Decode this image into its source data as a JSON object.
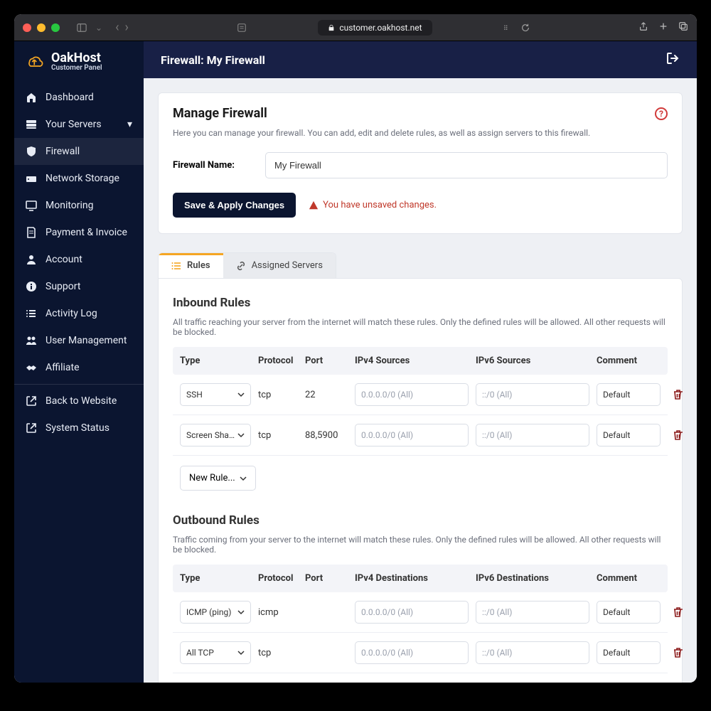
{
  "browser": {
    "url": "customer.oakhost.net"
  },
  "brand": {
    "name": "OakHost",
    "subtitle": "Customer Panel"
  },
  "sidebar": {
    "items": [
      {
        "label": "Dashboard"
      },
      {
        "label": "Your Servers"
      },
      {
        "label": "Firewall"
      },
      {
        "label": "Network Storage"
      },
      {
        "label": "Monitoring"
      },
      {
        "label": "Payment & Invoice"
      },
      {
        "label": "Account"
      },
      {
        "label": "Support"
      },
      {
        "label": "Activity Log"
      },
      {
        "label": "User Management"
      },
      {
        "label": "Affiliate"
      },
      {
        "label": "Back to Website"
      },
      {
        "label": "System Status"
      }
    ]
  },
  "topbar": {
    "title": "Firewall: My Firewall"
  },
  "manage": {
    "heading": "Manage Firewall",
    "description": "Here you can manage your firewall. You can add, edit and delete rules, as well as assign servers to this firewall.",
    "name_label": "Firewall Name:",
    "name_value": "My Firewall",
    "save_label": "Save & Apply Changes",
    "unsaved_msg": "You have unsaved changes."
  },
  "tabs": {
    "rules": "Rules",
    "assigned": "Assigned Servers"
  },
  "inbound": {
    "title": "Inbound Rules",
    "description": "All traffic reaching your server from the internet will match these rules. Only the defined rules will be allowed. All other requests will be blocked.",
    "columns": {
      "type": "Type",
      "protocol": "Protocol",
      "port": "Port",
      "v4": "IPv4 Sources",
      "v6": "IPv6 Sources",
      "comment": "Comment"
    },
    "rows": [
      {
        "type": "SSH",
        "protocol": "tcp",
        "port": "22",
        "v4_placeholder": "0.0.0.0/0 (All)",
        "v6_placeholder": "::/0 (All)",
        "comment": "Default"
      },
      {
        "type": "Screen Sharing",
        "protocol": "tcp",
        "port": "88,5900",
        "v4_placeholder": "0.0.0.0/0 (All)",
        "v6_placeholder": "::/0 (All)",
        "comment": "Default"
      }
    ],
    "new_rule_label": "New Rule..."
  },
  "outbound": {
    "title": "Outbound Rules",
    "description": "Traffic coming from your server to the internet will match these rules. Only the defined rules will be allowed. All other requests will be blocked.",
    "columns": {
      "type": "Type",
      "protocol": "Protocol",
      "port": "Port",
      "v4": "IPv4 Destinations",
      "v6": "IPv6 Destinations",
      "comment": "Comment"
    },
    "rows": [
      {
        "type": "ICMP (ping)",
        "protocol": "icmp",
        "port": "",
        "v4_placeholder": "0.0.0.0/0 (All)",
        "v6_placeholder": "::/0 (All)",
        "comment": "Default"
      },
      {
        "type": "All TCP",
        "protocol": "tcp",
        "port": "",
        "v4_placeholder": "0.0.0.0/0 (All)",
        "v6_placeholder": "::/0 (All)",
        "comment": "Default"
      }
    ]
  }
}
